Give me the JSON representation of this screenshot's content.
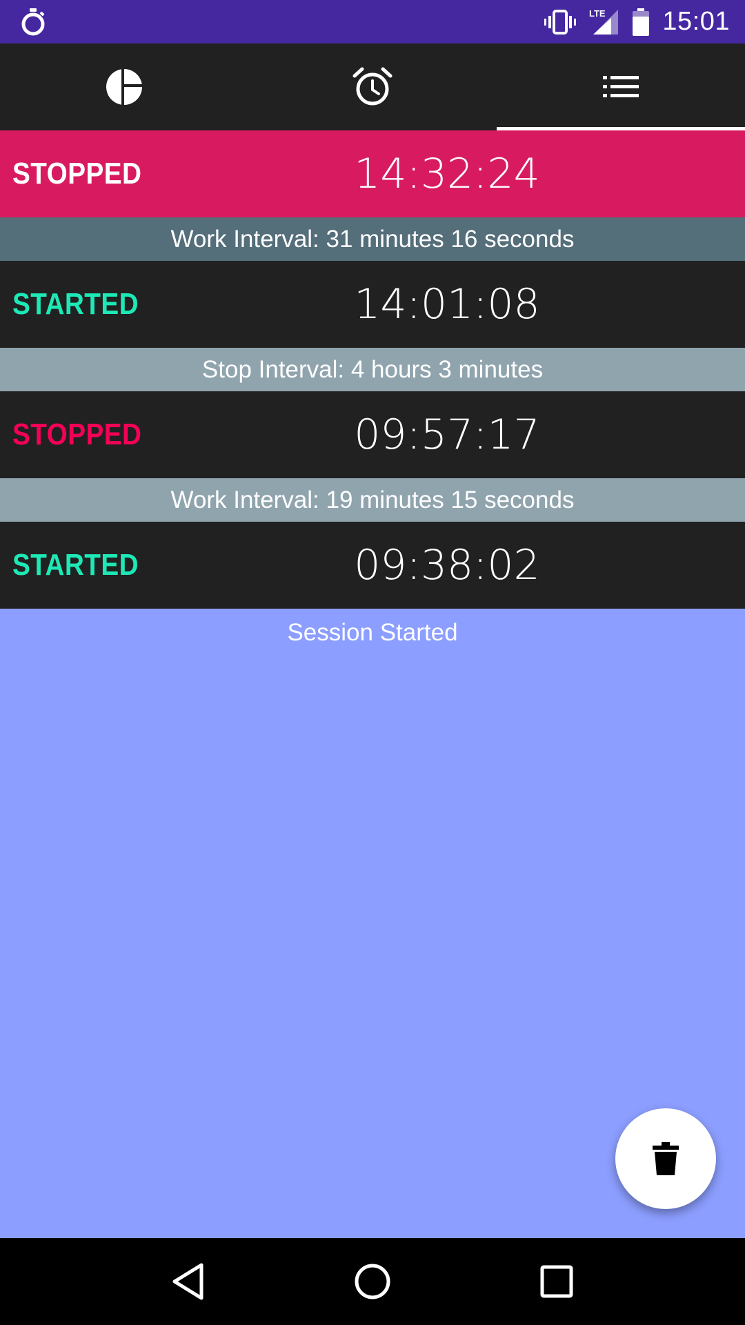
{
  "status_bar": {
    "time": "15:01",
    "left_icon": "stopwatch-notification-icon",
    "icons": [
      "vibrate-icon",
      "lte-signal-icon",
      "battery-icon"
    ],
    "network_label": "LTE"
  },
  "tabs": [
    {
      "name": "statistics",
      "icon": "pie-chart-icon",
      "active": false
    },
    {
      "name": "timer",
      "icon": "alarm-clock-icon",
      "active": false
    },
    {
      "name": "log",
      "icon": "list-icon",
      "active": true
    }
  ],
  "log": {
    "entries": [
      {
        "type": "event",
        "label": "STOPPED",
        "time": "14:32:24",
        "label_color": "#ffffff",
        "row_color": "#d81b60"
      },
      {
        "type": "interval",
        "text": "Work Interval: 31 minutes 16 seconds",
        "row_color": "#546e7a"
      },
      {
        "type": "event",
        "label": "STARTED",
        "time": "14:01:08",
        "label_color": "#1de9b6",
        "row_color": "#212121"
      },
      {
        "type": "interval",
        "text": "Stop Interval: 4 hours 3 minutes",
        "row_color": "#90a4ae"
      },
      {
        "type": "event",
        "label": "STOPPED",
        "time": "09:57:17",
        "label_color": "#f50057",
        "row_color": "#212121"
      },
      {
        "type": "interval",
        "text": "Work Interval: 19 minutes 15 seconds",
        "row_color": "#90a4ae"
      },
      {
        "type": "event",
        "label": "STARTED",
        "time": "09:38:02",
        "label_color": "#1de9b6",
        "row_color": "#212121"
      }
    ],
    "session_text": "Session Started"
  },
  "fab": {
    "icon": "trash-icon"
  },
  "nav": {
    "icons": [
      "back-icon",
      "home-icon",
      "recents-icon"
    ]
  },
  "colors": {
    "status_bar": "#4527a0",
    "tab_bar": "#212121",
    "background": "#8c9eff",
    "started": "#1de9b6",
    "stopped": "#f50057",
    "highlight": "#d81b60"
  }
}
